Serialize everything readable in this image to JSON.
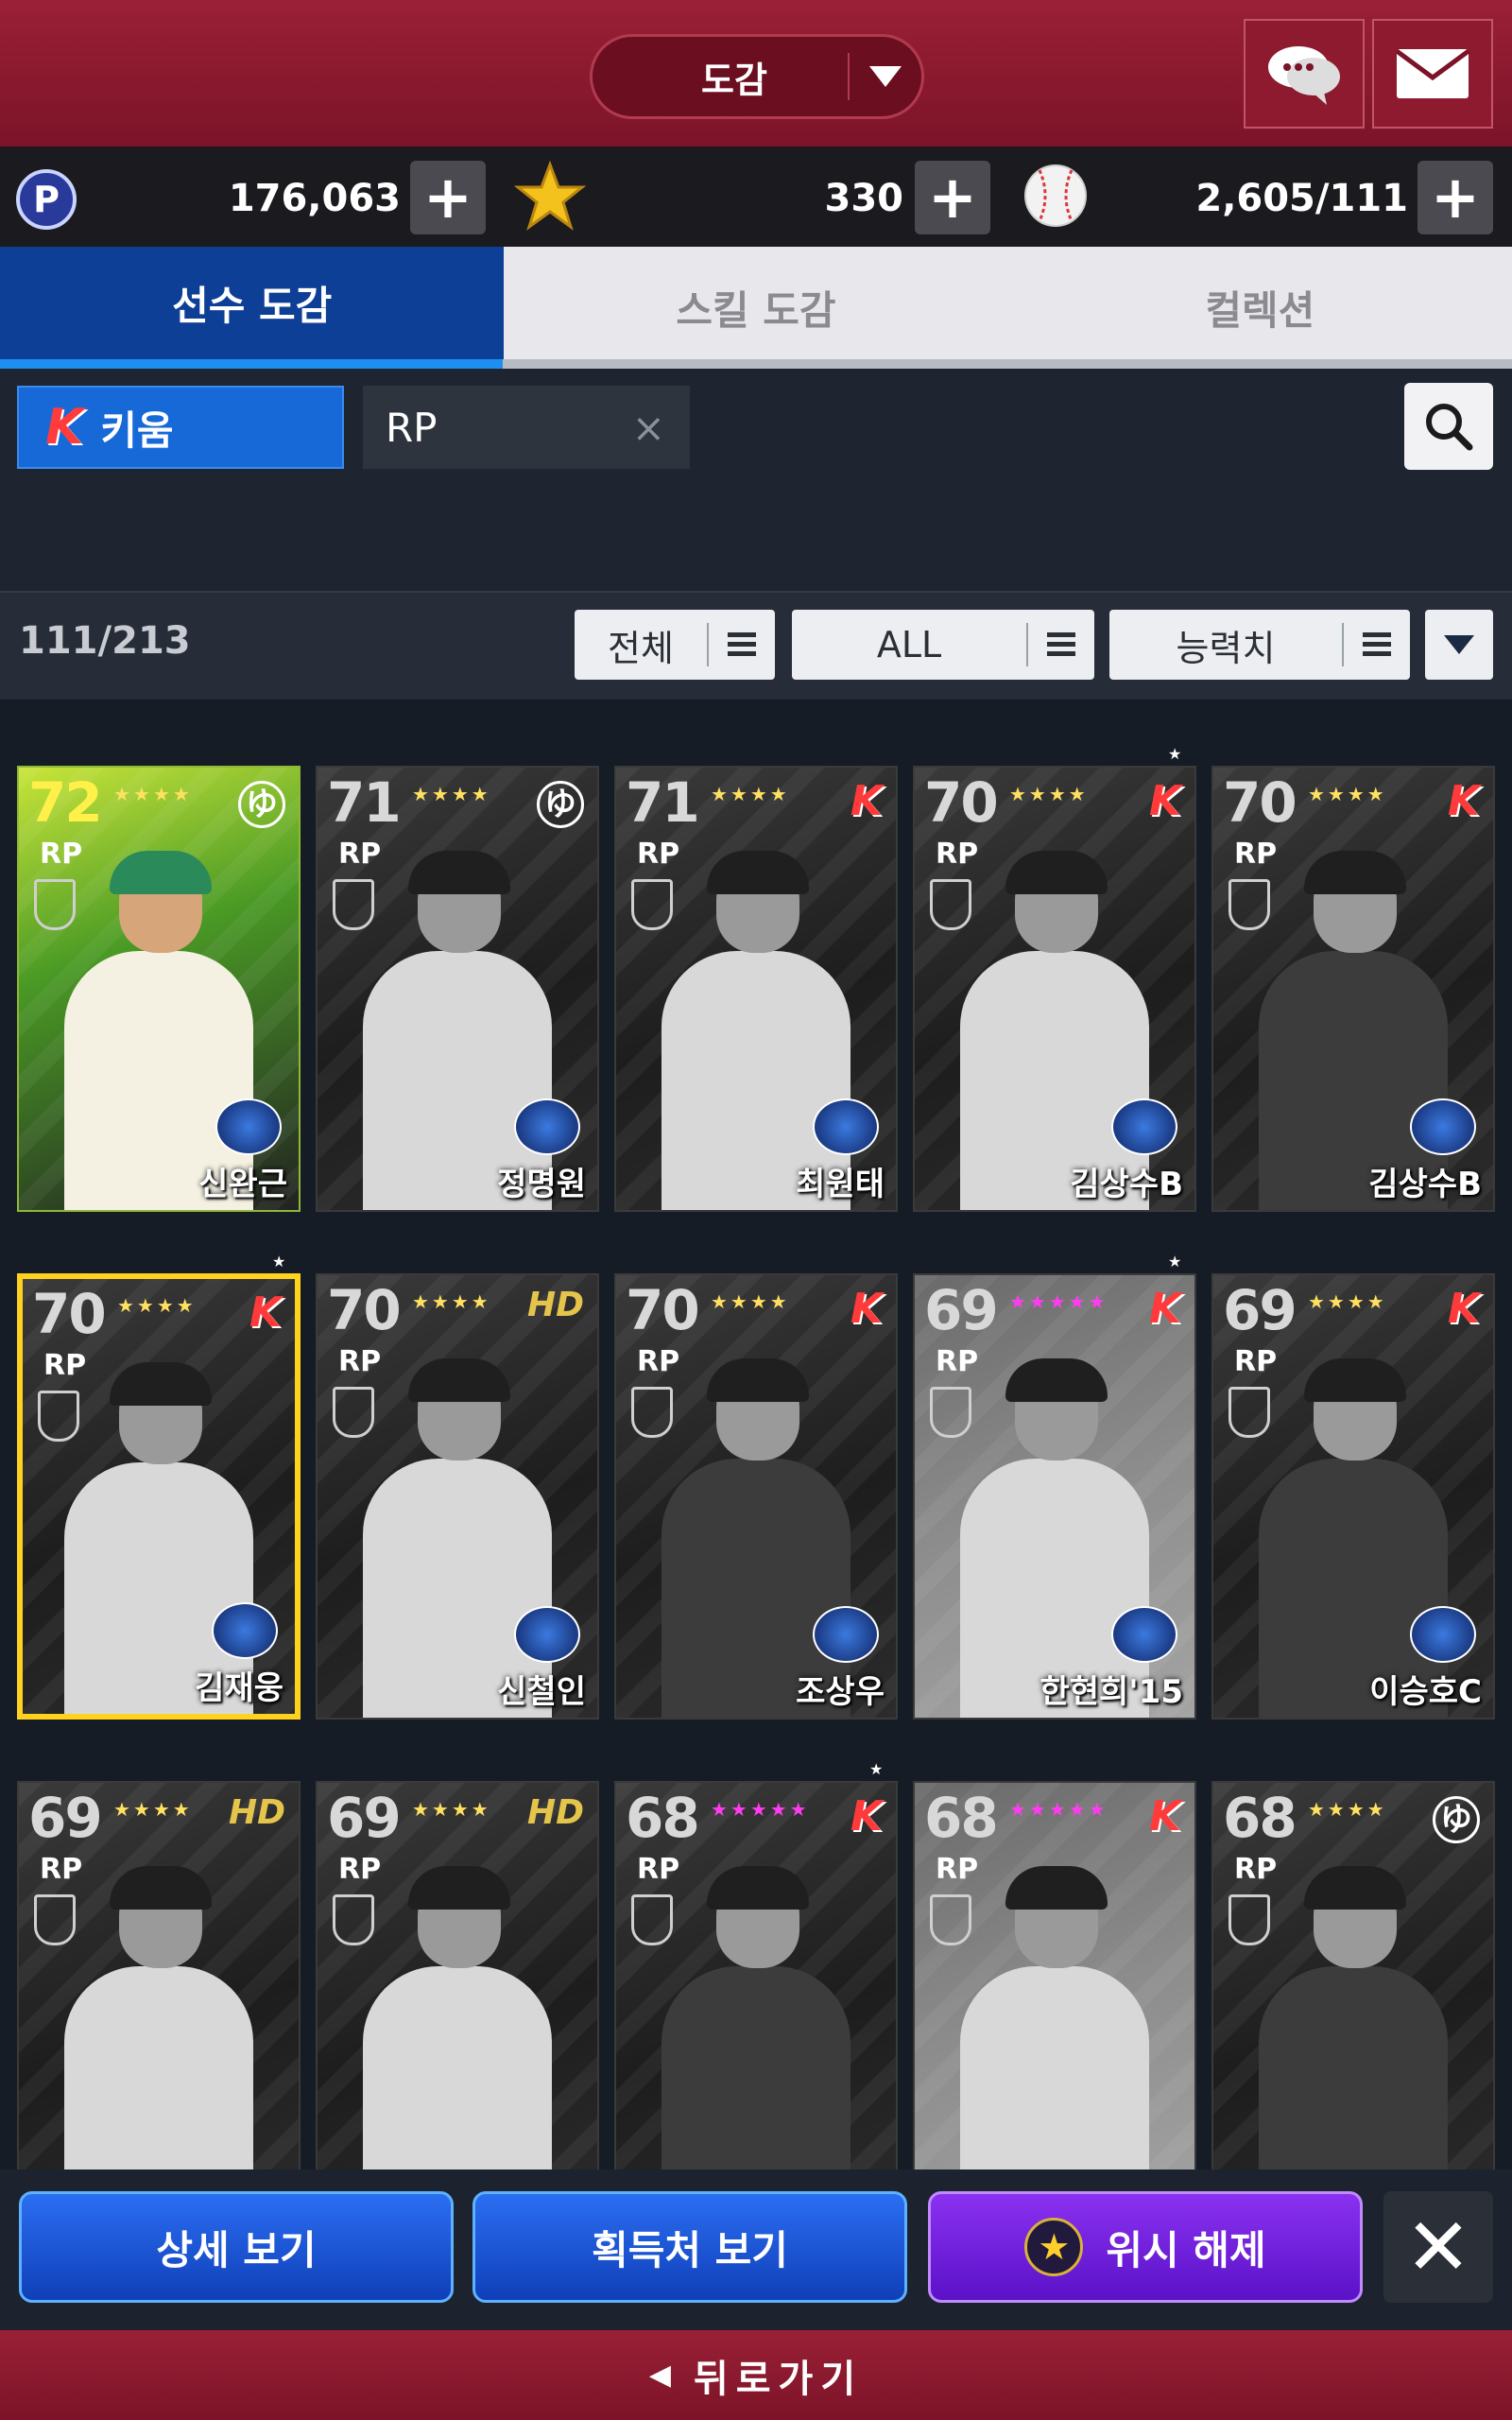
{
  "header": {
    "title": "도감"
  },
  "currency": {
    "points": "176,063",
    "stars": "330",
    "balls": "2,605/111",
    "plus": "+"
  },
  "tabs": [
    "선수 도감",
    "스킬 도감",
    "컬렉션"
  ],
  "filters": {
    "team": "키움",
    "position": "RP",
    "clear": "×",
    "team_logo": "K"
  },
  "sort": {
    "count": "111/213",
    "filter1": "전체",
    "filter2": "ALL",
    "filter3": "능력치"
  },
  "cards": [
    {
      "ovr": "72",
      "pos": "RP",
      "name": "신완근",
      "stars": "★★★★",
      "team": "dot",
      "team_text": "ゆ",
      "style": "bright",
      "wish": false
    },
    {
      "ovr": "71",
      "pos": "RP",
      "name": "정명원",
      "stars": "★★★★",
      "team": "dot",
      "team_text": "ゆ",
      "style": "dark",
      "wish": false
    },
    {
      "ovr": "71",
      "pos": "RP",
      "name": "최원태",
      "stars": "★★★★",
      "team": "k",
      "team_text": "K",
      "style": "dark",
      "wish": false
    },
    {
      "ovr": "70",
      "pos": "RP",
      "name": "김상수B",
      "stars": "★★★★",
      "team": "k",
      "team_text": "K",
      "style": "dark",
      "wish": true
    },
    {
      "ovr": "70",
      "pos": "RP",
      "name": "김상수B",
      "stars": "★★★★",
      "team": "k",
      "team_text": "K",
      "style": "dark",
      "wish": false
    },
    {
      "ovr": "70",
      "pos": "RP",
      "name": "김재웅",
      "stars": "★★★★",
      "team": "k",
      "team_text": "K",
      "style": "selected",
      "wish": true
    },
    {
      "ovr": "70",
      "pos": "RP",
      "name": "신철인",
      "stars": "★★★★",
      "team": "hd",
      "team_text": "HD",
      "style": "dark",
      "wish": false
    },
    {
      "ovr": "70",
      "pos": "RP",
      "name": "조상우",
      "stars": "★★★★",
      "team": "k",
      "team_text": "K",
      "style": "dark",
      "wish": false
    },
    {
      "ovr": "69",
      "pos": "RP",
      "name": "한현희'15",
      "stars": "★★★★★",
      "pink": true,
      "team": "k",
      "team_text": "K",
      "style": "light",
      "wish": true
    },
    {
      "ovr": "69",
      "pos": "RP",
      "name": "이승호C",
      "stars": "★★★★",
      "team": "k",
      "team_text": "K",
      "style": "dark",
      "wish": false
    },
    {
      "ovr": "69",
      "pos": "RP",
      "name": "",
      "stars": "★★★★",
      "team": "hd",
      "team_text": "HD",
      "style": "dark",
      "wish": false
    },
    {
      "ovr": "69",
      "pos": "RP",
      "name": "",
      "stars": "★★★★",
      "team": "hd",
      "team_text": "HD",
      "style": "dark",
      "wish": false
    },
    {
      "ovr": "68",
      "pos": "RP",
      "name": "",
      "stars": "★★★★★",
      "pink": true,
      "team": "k",
      "team_text": "K",
      "style": "dark",
      "wish": true
    },
    {
      "ovr": "68",
      "pos": "RP",
      "name": "",
      "stars": "★★★★★",
      "pink": true,
      "team": "k",
      "team_text": "K",
      "style": "light",
      "wish": false
    },
    {
      "ovr": "68",
      "pos": "RP",
      "name": "",
      "stars": "★★★★",
      "team": "dot",
      "team_text": "ゆ",
      "style": "dark",
      "wish": false
    }
  ],
  "actions": {
    "detail": "상세 보기",
    "source": "획득처 보기",
    "unwish": "위시 해제",
    "close": "✕",
    "back": "뒤로가기",
    "back_arrow": "◀",
    "wish_star": "★"
  }
}
